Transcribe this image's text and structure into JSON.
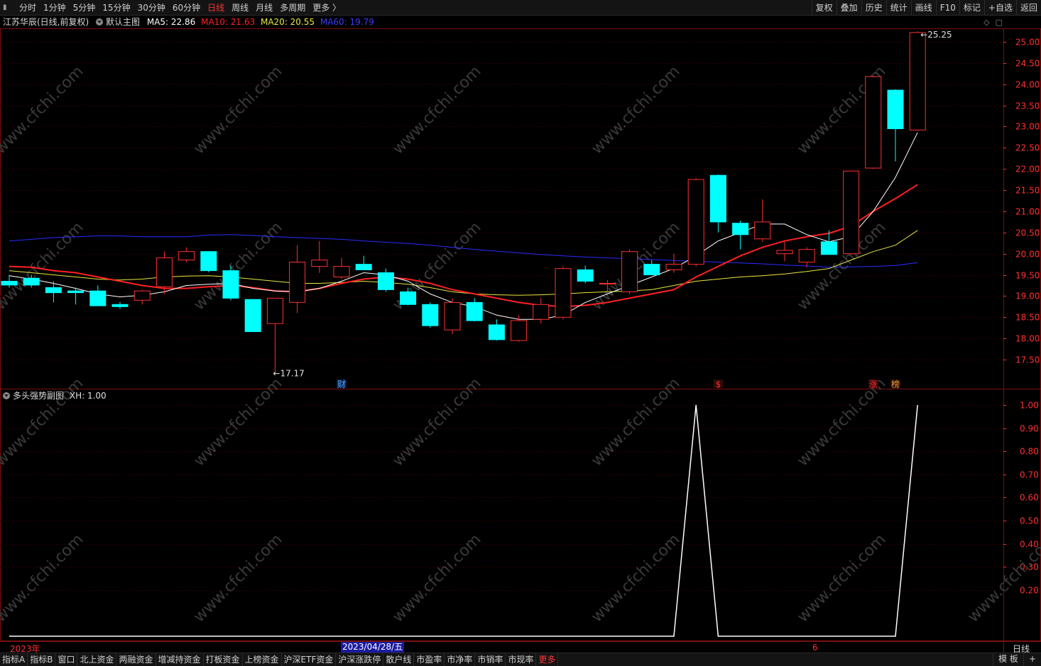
{
  "toolbar": {
    "periods": [
      {
        "label": "分时",
        "active": false
      },
      {
        "label": "1分钟",
        "active": false
      },
      {
        "label": "5分钟",
        "active": false
      },
      {
        "label": "15分钟",
        "active": false
      },
      {
        "label": "30分钟",
        "active": false
      },
      {
        "label": "60分钟",
        "active": false
      },
      {
        "label": "日线",
        "active": true
      },
      {
        "label": "周线",
        "active": false
      },
      {
        "label": "月线",
        "active": false
      },
      {
        "label": "多周期",
        "active": false
      },
      {
        "label": "更多 〉",
        "active": false
      }
    ],
    "tools": [
      "复权",
      "叠加",
      "历史",
      "统计",
      "画线",
      "F10",
      "标记",
      "+自选",
      "返回"
    ]
  },
  "main_info": {
    "stock": "江苏华辰(日线,前复权)",
    "indicator": "默认主图",
    "ma5": "MA5: 22.86",
    "ma10": "MA10: 21.63",
    "ma20": "MA20: 20.55",
    "ma60": "MA60: 19.79"
  },
  "sub_info": {
    "indicator": "多头强势副图",
    "xh": "XH: 1.00"
  },
  "colors": {
    "up": "#ff3030",
    "down": "#00ffff",
    "ma5": "#ffffff",
    "ma10": "#ff2020",
    "ma20": "#e8e840",
    "ma60": "#2b2bff",
    "axis": "#ff3030",
    "grid": "#4a0000",
    "border": "#7a1010",
    "markFin": "#4aa3ff",
    "markDollar": "#ff3030",
    "markZhang": "#ff3030",
    "markBang": "#e8a030"
  },
  "price_axis": {
    "ticks": [
      "25.00",
      "24.50",
      "24.00",
      "23.50",
      "23.00",
      "22.50",
      "22.00",
      "21.50",
      "21.00",
      "20.50",
      "20.00",
      "19.50",
      "19.00",
      "18.50",
      "18.00",
      "17.50"
    ]
  },
  "sub_axis": {
    "ticks": [
      "1.00",
      "0.90",
      "0.80",
      "0.70",
      "0.60",
      "0.50",
      "0.40",
      "0.30",
      "0.20"
    ]
  },
  "annotations": {
    "high": "25.25",
    "low": "17.17"
  },
  "marks": [
    {
      "text": "财",
      "candle": 15,
      "kind": "fin"
    },
    {
      "text": "$",
      "candle": 32,
      "kind": "dollar"
    },
    {
      "text": "涨",
      "candle": 39,
      "kind": "zhang"
    },
    {
      "text": "榜",
      "candle": 40,
      "kind": "bang"
    }
  ],
  "time_labels": {
    "year": "2023年",
    "cursor": "2023/04/28/五",
    "month": "6",
    "period": "日线"
  },
  "bottom_tabs": [
    "指标A",
    "指标B",
    "窗口",
    "北上资金",
    "两融资金",
    "增减持资金",
    "打板资金",
    "上榜资金",
    "沪深ETF资金",
    "沪深涨跌停",
    "散户线",
    "市盈率",
    "市净率",
    "市销率",
    "市现率",
    "更多"
  ],
  "bottom_right": [
    "模 板",
    "+"
  ],
  "watermark": "www.cfchi.com",
  "chart_data": [
    {
      "type": "candlestick",
      "title": "江苏华辰(日线,前复权)",
      "ylim": [
        17.0,
        25.5
      ],
      "candles": [
        {
          "o": 19.35,
          "h": 19.5,
          "l": 19.2,
          "c": 19.26
        },
        {
          "o": 19.42,
          "h": 19.5,
          "l": 19.2,
          "c": 19.26
        },
        {
          "o": 19.2,
          "h": 19.35,
          "l": 18.85,
          "c": 19.08
        },
        {
          "o": 19.12,
          "h": 19.2,
          "l": 18.8,
          "c": 19.08
        },
        {
          "o": 19.12,
          "h": 19.25,
          "l": 18.8,
          "c": 18.77
        },
        {
          "o": 18.8,
          "h": 18.86,
          "l": 18.7,
          "c": 18.75
        },
        {
          "o": 18.9,
          "h": 19.15,
          "l": 18.8,
          "c": 19.12
        },
        {
          "o": 19.22,
          "h": 20.05,
          "l": 19.05,
          "c": 19.9
        },
        {
          "o": 19.85,
          "h": 20.15,
          "l": 19.8,
          "c": 20.05
        },
        {
          "o": 20.05,
          "h": 20.05,
          "l": 19.56,
          "c": 19.6
        },
        {
          "o": 19.6,
          "h": 19.72,
          "l": 18.9,
          "c": 18.95
        },
        {
          "o": 18.92,
          "h": 18.92,
          "l": 18.15,
          "c": 18.16
        },
        {
          "o": 18.35,
          "h": 18.95,
          "l": 17.17,
          "c": 18.95
        },
        {
          "o": 18.85,
          "h": 20.2,
          "l": 18.6,
          "c": 19.8
        },
        {
          "o": 19.7,
          "h": 20.3,
          "l": 19.55,
          "c": 19.85
        },
        {
          "o": 19.45,
          "h": 19.9,
          "l": 19.4,
          "c": 19.7
        },
        {
          "o": 19.75,
          "h": 19.95,
          "l": 19.62,
          "c": 19.62
        },
        {
          "o": 19.55,
          "h": 19.65,
          "l": 19.1,
          "c": 19.15
        },
        {
          "o": 19.1,
          "h": 19.2,
          "l": 18.78,
          "c": 18.8
        },
        {
          "o": 18.8,
          "h": 18.85,
          "l": 18.25,
          "c": 18.3
        },
        {
          "o": 18.2,
          "h": 18.95,
          "l": 18.1,
          "c": 18.85
        },
        {
          "o": 18.85,
          "h": 18.95,
          "l": 18.4,
          "c": 18.42
        },
        {
          "o": 18.32,
          "h": 18.45,
          "l": 17.95,
          "c": 17.97
        },
        {
          "o": 17.95,
          "h": 18.55,
          "l": 17.92,
          "c": 18.42
        },
        {
          "o": 18.45,
          "h": 18.95,
          "l": 18.35,
          "c": 18.8
        },
        {
          "o": 18.5,
          "h": 19.7,
          "l": 18.45,
          "c": 19.65
        },
        {
          "o": 19.62,
          "h": 19.72,
          "l": 19.3,
          "c": 19.35
        },
        {
          "o": 19.3,
          "h": 19.38,
          "l": 19.1,
          "c": 19.3
        },
        {
          "o": 19.1,
          "h": 20.1,
          "l": 19.05,
          "c": 20.05
        },
        {
          "o": 19.75,
          "h": 19.85,
          "l": 19.55,
          "c": 19.5
        },
        {
          "o": 19.62,
          "h": 20.0,
          "l": 19.55,
          "c": 19.75
        },
        {
          "o": 19.75,
          "h": 21.78,
          "l": 19.7,
          "c": 21.75
        },
        {
          "o": 21.85,
          "h": 21.87,
          "l": 20.5,
          "c": 20.75
        },
        {
          "o": 20.72,
          "h": 20.78,
          "l": 20.1,
          "c": 20.45
        },
        {
          "o": 20.35,
          "h": 21.28,
          "l": 20.28,
          "c": 20.75
        },
        {
          "o": 20.0,
          "h": 20.3,
          "l": 19.82,
          "c": 20.08
        },
        {
          "o": 19.8,
          "h": 20.15,
          "l": 19.68,
          "c": 20.1
        },
        {
          "o": 20.28,
          "h": 20.55,
          "l": 20.0,
          "c": 19.98
        },
        {
          "o": 20.0,
          "h": 21.95,
          "l": 19.98,
          "c": 21.95
        },
        {
          "o": 22.02,
          "h": 24.2,
          "l": 22.0,
          "c": 24.18
        },
        {
          "o": 23.86,
          "h": 23.88,
          "l": 22.18,
          "c": 22.95
        },
        {
          "o": 22.92,
          "h": 25.25,
          "l": 22.9,
          "c": 25.22
        }
      ],
      "series": [
        {
          "name": "MA5",
          "values": [
            19.48,
            19.4,
            19.3,
            19.18,
            19.05,
            18.98,
            19.02,
            19.1,
            19.25,
            19.28,
            19.3,
            19.18,
            19.12,
            19.1,
            19.18,
            19.35,
            19.55,
            19.5,
            19.35,
            19.05,
            18.85,
            18.75,
            18.55,
            18.45,
            18.45,
            18.55,
            18.85,
            19.05,
            19.25,
            19.45,
            19.65,
            19.95,
            20.3,
            20.5,
            20.7,
            20.7,
            20.45,
            20.28,
            20.4,
            21.0,
            21.8,
            22.86
          ]
        },
        {
          "name": "MA10",
          "values": [
            19.7,
            19.68,
            19.6,
            19.55,
            19.45,
            19.35,
            19.25,
            19.18,
            19.18,
            19.22,
            19.25,
            19.2,
            19.12,
            19.1,
            19.18,
            19.3,
            19.4,
            19.45,
            19.4,
            19.3,
            19.15,
            19.05,
            18.95,
            18.85,
            18.78,
            18.75,
            18.78,
            18.85,
            18.95,
            19.05,
            19.15,
            19.45,
            19.7,
            19.95,
            20.15,
            20.3,
            20.4,
            20.48,
            20.65,
            21.0,
            21.3,
            21.63
          ]
        },
        {
          "name": "MA20",
          "values": [
            19.6,
            19.55,
            19.5,
            19.45,
            19.4,
            19.38,
            19.4,
            19.45,
            19.47,
            19.48,
            19.45,
            19.4,
            19.35,
            19.3,
            19.3,
            19.32,
            19.35,
            19.32,
            19.28,
            19.2,
            19.1,
            19.05,
            19.03,
            19.02,
            19.03,
            19.05,
            19.08,
            19.1,
            19.12,
            19.15,
            19.25,
            19.35,
            19.4,
            19.45,
            19.48,
            19.52,
            19.58,
            19.65,
            19.85,
            20.05,
            20.2,
            20.55
          ]
        },
        {
          "name": "MA60",
          "values": [
            20.3,
            20.34,
            20.38,
            20.4,
            20.42,
            20.42,
            20.4,
            20.4,
            20.4,
            20.44,
            20.45,
            20.43,
            20.4,
            20.38,
            20.36,
            20.34,
            20.3,
            20.27,
            20.24,
            20.2,
            20.15,
            20.1,
            20.06,
            20.02,
            19.98,
            19.95,
            19.92,
            19.9,
            19.88,
            19.86,
            19.84,
            19.82,
            19.8,
            19.78,
            19.76,
            19.73,
            19.71,
            19.68,
            19.69,
            19.7,
            19.72,
            19.79
          ]
        }
      ]
    },
    {
      "type": "line",
      "title": "多头强势副图",
      "ylim": [
        0,
        1.0
      ],
      "series": [
        {
          "name": "XH",
          "values": [
            0,
            0,
            0,
            0,
            0,
            0,
            0,
            0,
            0,
            0,
            0,
            0,
            0,
            0,
            0,
            0,
            0,
            0,
            0,
            0,
            0,
            0,
            0,
            0,
            0,
            0,
            0,
            0,
            0,
            0,
            0,
            1,
            0,
            0,
            0,
            0,
            0,
            0,
            0,
            0,
            0,
            1
          ]
        }
      ]
    }
  ]
}
